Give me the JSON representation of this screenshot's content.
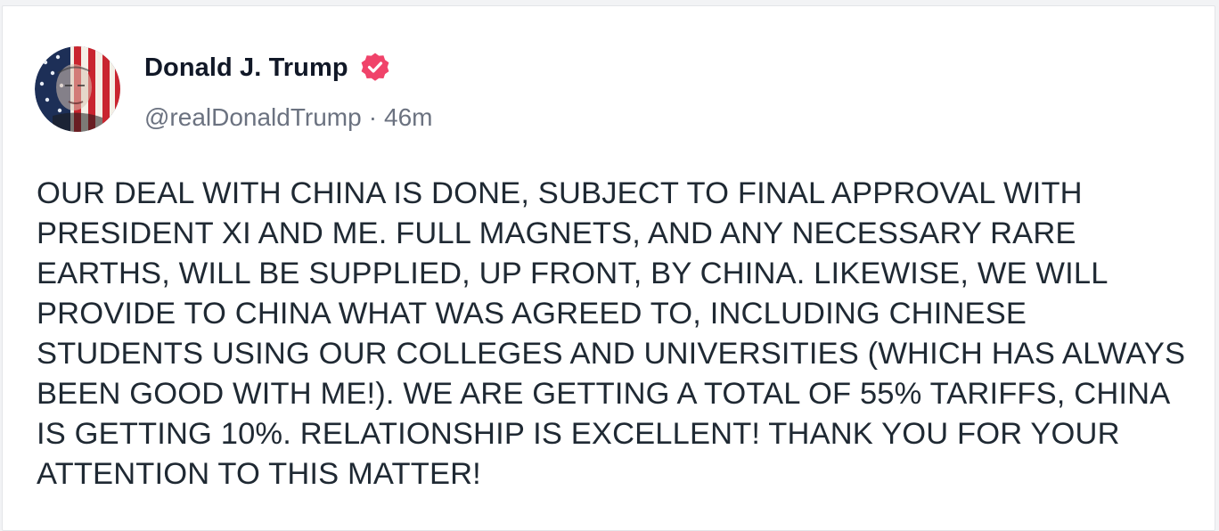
{
  "post": {
    "author": {
      "display_name": "Donald J. Trump",
      "handle": "@realDonaldTrump",
      "verified": true,
      "avatar_icon": "flag-portrait-avatar",
      "verified_icon": "verified-badge-icon"
    },
    "separator": "·",
    "time_ago": "46m",
    "body": "OUR DEAL WITH CHINA IS DONE, SUBJECT TO FINAL APPROVAL WITH PRESIDENT XI AND ME. FULL MAGNETS, AND ANY NECESSARY RARE EARTHS, WILL BE SUPPLIED, UP FRONT, BY CHINA. LIKEWISE, WE WILL PROVIDE TO CHINA WHAT WAS AGREED TO, INCLUDING CHINESE STUDENTS USING OUR COLLEGES AND UNIVERSITIES (WHICH HAS ALWAYS BEEN GOOD WITH ME!). WE ARE GETTING A TOTAL OF 55% TARIFFS, CHINA IS GETTING 10%. RELATIONSHIP IS EXCELLENT! THANK YOU FOR YOUR ATTENTION TO THIS MATTER!"
  },
  "colors": {
    "verified_badge": "#f0436a",
    "text_primary": "#111827",
    "text_secondary": "#6b7280",
    "card_background": "#ffffff"
  }
}
